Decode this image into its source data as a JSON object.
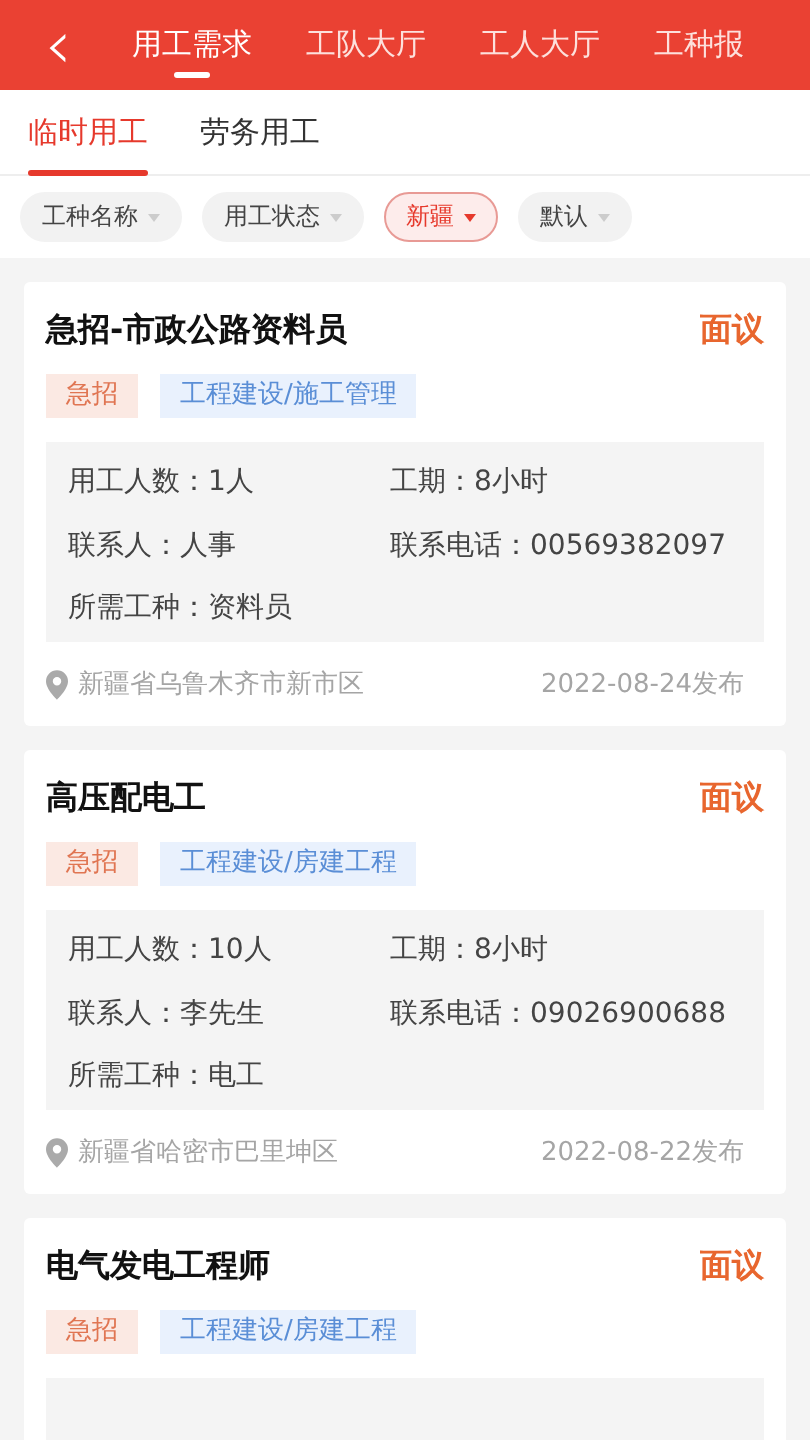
{
  "header": {
    "back": "‹",
    "tabs": [
      {
        "label": "用工需求",
        "selected": true
      },
      {
        "label": "工队大厅",
        "selected": false
      },
      {
        "label": "工人大厅",
        "selected": false
      },
      {
        "label": "工种报",
        "selected": false
      }
    ]
  },
  "subtabs": [
    {
      "label": "临时用工",
      "selected": true
    },
    {
      "label": "劳务用工",
      "selected": false
    }
  ],
  "filters": [
    {
      "label": "工种名称",
      "selected": false
    },
    {
      "label": "用工状态",
      "selected": false
    },
    {
      "label": "新疆",
      "selected": true
    },
    {
      "label": "默认",
      "selected": false
    }
  ],
  "jobs": [
    {
      "title": "急招-市政公路资料员",
      "pay": "面议",
      "tags": [
        {
          "label": "急招",
          "kind": "urgent"
        },
        {
          "label": "工程建设/施工管理",
          "kind": "category"
        }
      ],
      "details": [
        "用工人数：1人",
        "工期：8小时",
        "联系人：人事",
        "联系电话：00569382097",
        "所需工种：资料员"
      ],
      "location": "新疆省乌鲁木齐市新市区",
      "date": "2022-08-24发布"
    },
    {
      "title": "高压配电工",
      "pay": "面议",
      "tags": [
        {
          "label": "急招",
          "kind": "urgent"
        },
        {
          "label": "工程建设/房建工程",
          "kind": "category"
        }
      ],
      "details": [
        "用工人数：10人",
        "工期：8小时",
        "联系人：李先生",
        "联系电话：09026900688",
        "所需工种：电工"
      ],
      "location": "新疆省哈密市巴里坤区",
      "date": "2022-08-22发布"
    },
    {
      "title": "电气发电工程师",
      "pay": "面议",
      "tags": [
        {
          "label": "急招",
          "kind": "urgent"
        },
        {
          "label": "工程建设/房建工程",
          "kind": "category"
        }
      ]
    }
  ]
}
